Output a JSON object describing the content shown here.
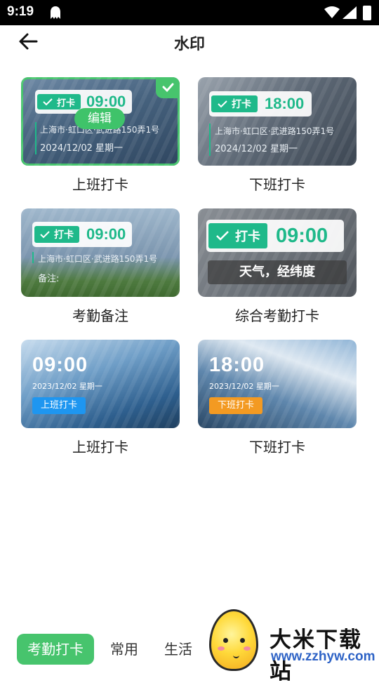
{
  "status_bar": {
    "time": "9:19"
  },
  "header": {
    "title": "水印"
  },
  "cards": [
    {
      "caption": "上班打卡",
      "tag": "打卡",
      "time": "09:00",
      "address": "上海市·虹口区·武进路150弄1号",
      "date": "2024/12/02  星期一",
      "edit_label": "编辑",
      "selected": true
    },
    {
      "caption": "下班打卡",
      "tag": "打卡",
      "time": "18:00",
      "address": "上海市·虹口区·武进路150弄1号",
      "date": "2024/12/02  星期一"
    },
    {
      "caption": "考勤备注",
      "tag": "打卡",
      "time": "09:00",
      "address": "上海市·虹口区·武进路150弄1号",
      "note": "备注:"
    },
    {
      "caption": "综合考勤打卡",
      "tag": "打卡",
      "time": "09:00",
      "weather": "天气，经纬度"
    },
    {
      "caption": "上班打卡",
      "time": "09:00",
      "date": "2023/12/02  星期一",
      "badge": "上班打卡",
      "badge_color": "#1e96f0"
    },
    {
      "caption": "下班打卡",
      "time": "18:00",
      "date": "2023/12/02  星期一",
      "badge": "下班打卡",
      "badge_color": "#f39a22"
    }
  ],
  "tabs": [
    {
      "label": "考勤打卡",
      "active": true
    },
    {
      "label": "常用"
    },
    {
      "label": "生活"
    }
  ],
  "watermark_logo": {
    "name": "大米下载站",
    "url": "www.zzhyw.com"
  },
  "colors": {
    "accent": "#47c46d",
    "watermark_green": "#1fb98a"
  }
}
